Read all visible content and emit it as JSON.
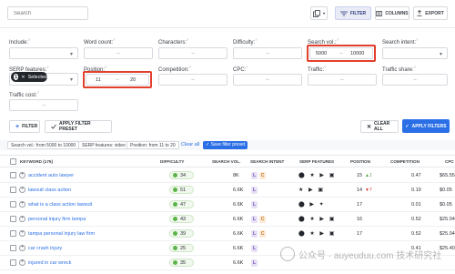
{
  "toolbar": {
    "search_placeholder": "Search",
    "filter_label": "FILTER",
    "columns_label": "COLUMNS",
    "export_label": "EXPORT"
  },
  "filters": {
    "include": "Include:",
    "word_count": "Word count:",
    "characters": "Characters:",
    "difficulty": "Difficulty:",
    "search_vol": "Search vol.:",
    "search_vol_min": "5000",
    "search_vol_max": "10000",
    "search_intent": "Search intent:",
    "serp_features": "SERP features:",
    "serp_selected_count": "1",
    "serp_selected_label": "Selected",
    "position": "Position:",
    "position_min": "11",
    "position_max": "20",
    "competition": "Competition:",
    "cpc": "CPC:",
    "traffic": "Traffic:",
    "traffic_share": "Traffic share:",
    "traffic_cost": "Traffic cost:",
    "dash": "–",
    "add_filter": "FILTER",
    "apply_preset": "APPLY FILTER PRESET",
    "clear_all": "CLEAR ALL",
    "apply_filters": "APPLY FILTERS"
  },
  "chips": {
    "chip1": "Search vol.: from 5000 to 10000",
    "chip2": "SERP features: video",
    "chip3": "Position: from 11 to 20",
    "clear_all": "Clear all",
    "save_preset": "Save filter preset"
  },
  "table": {
    "headers": {
      "keyword": "KEYWORD (175)",
      "difficulty": "DIFFICULTY",
      "search_vol": "SEARCH VOL.",
      "search_intent": "SEARCH INTENT",
      "serp_features": "SERP FEATURES",
      "position": "POSITION",
      "competition": "COMPETITION",
      "cpc": "CPC"
    },
    "rows": [
      {
        "keyword": "accident auto lawyer",
        "difficulty": "34",
        "search_vol": "8K",
        "intent": [
          "L",
          "C"
        ],
        "serp": "⬤ ★ ▶ ▣",
        "position": "15",
        "pos_change": "▲1",
        "competition": "0.47",
        "cpc": "$65.55"
      },
      {
        "keyword": "lawsuit class action",
        "difficulty": "51",
        "search_vol": "6.6K",
        "intent": [
          "L"
        ],
        "serp": "★ ▶ ▣",
        "position": "14",
        "pos_change": "▼7",
        "competition": "0.19",
        "cpc": "$0.05"
      },
      {
        "keyword": "what is a class action lawsuit",
        "difficulty": "47",
        "search_vol": "6.6K",
        "intent": [
          "L"
        ],
        "serp": "⬤ ▶ ✦",
        "position": "17",
        "pos_change": "",
        "competition": "0.01",
        "cpc": "$0.05"
      },
      {
        "keyword": "personal injury firm tampa",
        "difficulty": "43",
        "search_vol": "6.6K",
        "intent": [
          "L",
          "C"
        ],
        "serp": "⬤ ★ ▶ ▣",
        "position": "16",
        "pos_change": "",
        "competition": "0.52",
        "cpc": "$25.04"
      },
      {
        "keyword": "tampa personal injury law firm",
        "difficulty": "39",
        "search_vol": "6.6K",
        "intent": [
          "L",
          "C"
        ],
        "serp": "⬤ ★ ▶ ▣",
        "position": "17",
        "pos_change": "",
        "competition": "0.52",
        "cpc": "$25.04"
      },
      {
        "keyword": "car crash injury",
        "difficulty": "25",
        "search_vol": "6.6K",
        "intent": [
          "L"
        ],
        "serp": "",
        "position": "",
        "pos_change": "",
        "competition": "0.41",
        "cpc": "$25.40"
      },
      {
        "keyword": "injured in car wreck",
        "difficulty": "35",
        "search_vol": "6.6K",
        "intent": [
          "L"
        ],
        "serp": "",
        "position": "",
        "pos_change": "",
        "competition": "",
        "cpc": ""
      }
    ]
  },
  "watermark": {
    "text": "公众号 · auyeuduu.com 技术研究社"
  },
  "colors": {
    "accent": "#2b6fe6",
    "highlight": "#e2402c",
    "difficulty_green": "#5bb54a"
  }
}
